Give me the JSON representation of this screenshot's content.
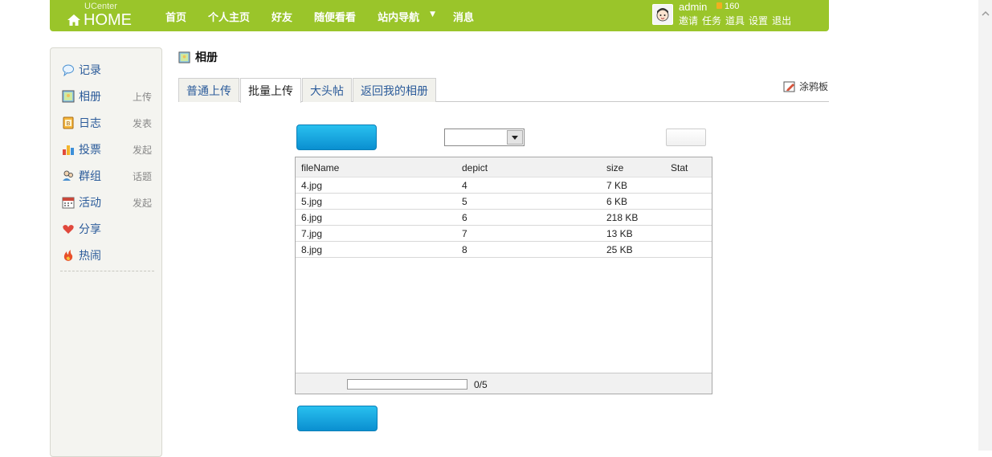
{
  "header": {
    "logo_small": "UCenter",
    "logo_big": "HOME",
    "nav": [
      "首页",
      "个人主页",
      "好友",
      "随便看看",
      "站内导航",
      "消息"
    ],
    "user": {
      "name": "admin",
      "credit": "160"
    },
    "user_links": [
      "邀请",
      "任务",
      "道具",
      "设置",
      "退出"
    ]
  },
  "sidebar": {
    "items": [
      {
        "label": "记录",
        "action": "",
        "icon": "speech-bubble-icon"
      },
      {
        "label": "相册",
        "action": "上传",
        "icon": "picture-icon"
      },
      {
        "label": "日志",
        "action": "发表",
        "icon": "notebook-icon"
      },
      {
        "label": "投票",
        "action": "发起",
        "icon": "bar-chart-icon"
      },
      {
        "label": "群组",
        "action": "话题",
        "icon": "group-icon"
      },
      {
        "label": "活动",
        "action": "发起",
        "icon": "calendar-icon"
      },
      {
        "label": "分享",
        "action": "",
        "icon": "heart-icon"
      },
      {
        "label": "热闹",
        "action": "",
        "icon": "fire-icon"
      }
    ]
  },
  "main": {
    "title": "相册",
    "tabs": [
      "普通上传",
      "批量上传",
      "大头帖",
      "返回我的相册"
    ],
    "active_tab": 1,
    "graffiti": "涂鸦板",
    "table": {
      "headers": [
        "fileName",
        "depict",
        "size",
        "Stat"
      ],
      "rows": [
        [
          "4.jpg",
          "4",
          "7 KB",
          ""
        ],
        [
          "5.jpg",
          "5",
          "6 KB",
          ""
        ],
        [
          "6.jpg",
          "6",
          "218 KB",
          ""
        ],
        [
          "7.jpg",
          "7",
          "13 KB",
          ""
        ],
        [
          "8.jpg",
          "8",
          "25 KB",
          ""
        ]
      ],
      "progress_text": "0/5",
      "progress_fraction": 0
    }
  },
  "colors": {
    "header_green": "#9ac52a",
    "link_blue": "#2b5b9a",
    "button_blue": "#1aa8e0"
  }
}
